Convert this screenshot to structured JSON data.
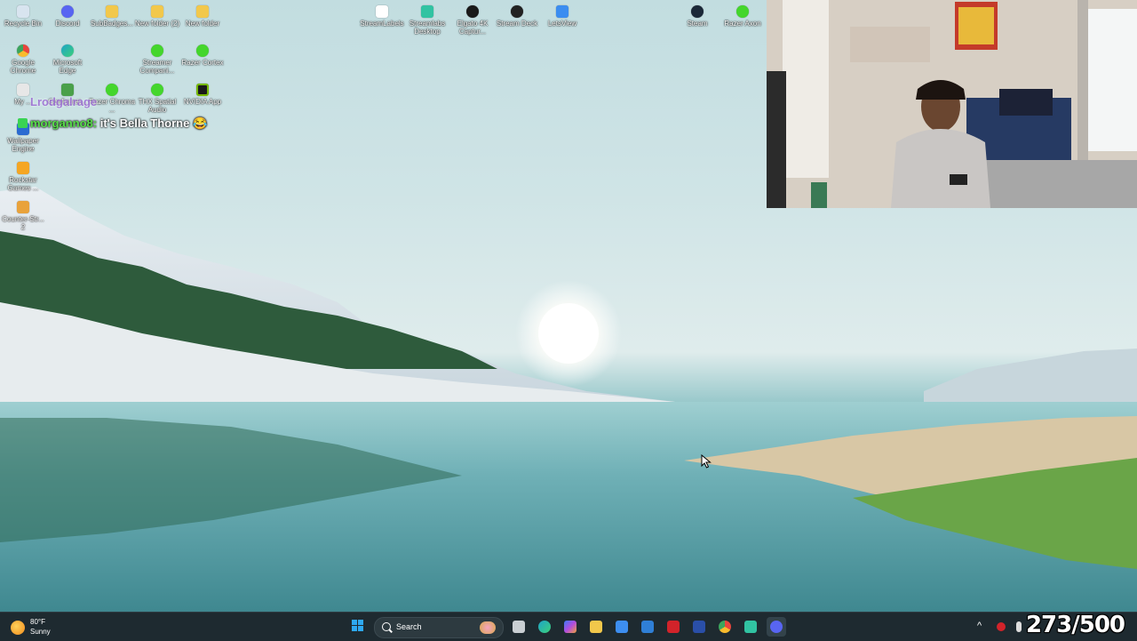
{
  "desktop_icons": [
    {
      "label": "Recycle Bin",
      "icon": "recycle-bin-icon",
      "color": "#d8e4ef"
    },
    {
      "label": "Discord",
      "icon": "discord-icon",
      "color": "#5865f2"
    },
    {
      "label": "SubBadges...",
      "icon": "folder-icon",
      "color": "#f2c84b"
    },
    {
      "label": "New folder (2)",
      "icon": "folder-icon",
      "color": "#f2c84b"
    },
    {
      "label": "New folder",
      "icon": "folder-icon",
      "color": "#f2c84b"
    },
    {
      "label": "StreamLabels",
      "icon": "streamlabels-icon",
      "color": "#ffffff"
    },
    {
      "label": "Streamlabs Desktop",
      "icon": "streamlabs-icon",
      "color": "#31c3a2"
    },
    {
      "label": "Elgato 4K Captur...",
      "icon": "elgato-icon",
      "color": "#1a1a1a"
    },
    {
      "label": "Stream Deck",
      "icon": "stream-deck-icon",
      "color": "#222222"
    },
    {
      "label": "LetsView",
      "icon": "letsview-icon",
      "color": "#3b8df0"
    },
    {
      "label": "Steam",
      "icon": "steam-icon",
      "color": "#1b2838"
    },
    {
      "label": "Razer Axon",
      "icon": "razer-icon",
      "color": "#44d62c"
    },
    {
      "label": "Google Chrome",
      "icon": "chrome-icon",
      "color": "#e8453c"
    },
    {
      "label": "Microsoft Edge",
      "icon": "edge-icon",
      "color": "#1fa4c8"
    },
    {
      "label": "Streamer Compani...",
      "icon": "razer-icon",
      "color": "#44d62c"
    },
    {
      "label": "Razer Cortex",
      "icon": "razer-icon",
      "color": "#44d62c"
    },
    {
      "label": "My ...",
      "icon": "app-icon",
      "color": "#e7e7e7"
    },
    {
      "label": "Configurat...",
      "icon": "app-icon",
      "color": "#4aa04a"
    },
    {
      "label": "Razer Chroma ...",
      "icon": "razer-icon",
      "color": "#44d62c"
    },
    {
      "label": "THX Spatial Audio",
      "icon": "thx-icon",
      "color": "#44d62c"
    },
    {
      "label": "NVIDIA App",
      "icon": "nvidia-icon",
      "color": "#76b900"
    },
    {
      "label": "Wallpaper Engine",
      "icon": "wallpaper-engine-icon",
      "color": "#2a6bd1"
    },
    {
      "label": "Rockstar Games ...",
      "icon": "rockstar-icon",
      "color": "#f5a623"
    },
    {
      "label": "Counter-Str... 2",
      "icon": "cs2-icon",
      "color": "#e9a23b"
    }
  ],
  "chat": {
    "ghost_text": "Lrodgalrage",
    "username": "morganno8:",
    "message": " it's Bella Thorne 😂"
  },
  "taskbar": {
    "weather": {
      "temp": "80°F",
      "condition": "Sunny"
    },
    "search_placeholder": "Search",
    "pinned_icons": [
      "windows-start-icon",
      "file-manager-icon",
      "edge-icon",
      "copilot-icon",
      "file-explorer-icon",
      "microsoft-store-icon",
      "vscode-like-icon",
      "mcafee-icon",
      "logitech-icon",
      "chrome-icon",
      "streamlabs-icon",
      "discord-icon"
    ],
    "tray": {
      "chevron": "^"
    }
  },
  "counter": "273/500",
  "colors": {
    "taskbar_bg": "#1e2a30",
    "chat_user": "#58e04a",
    "accent_windows": "#2ea8f2"
  }
}
